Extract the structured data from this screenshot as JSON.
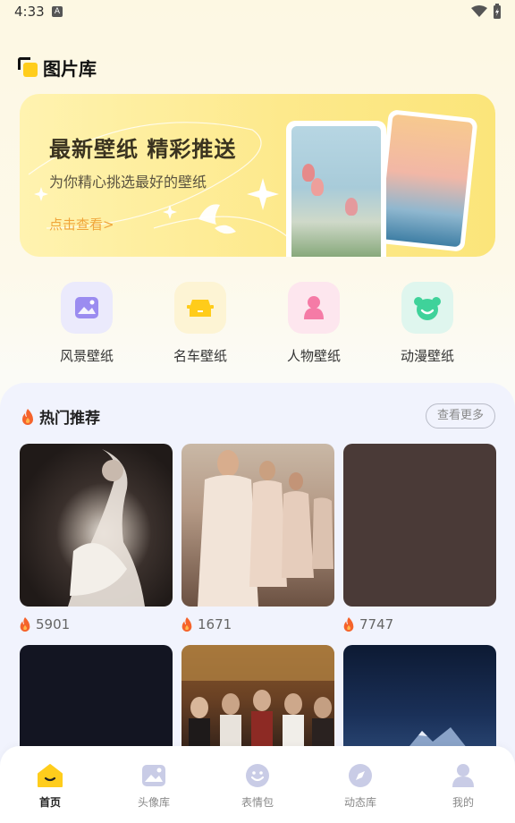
{
  "status": {
    "time": "4:33",
    "indicator": "A"
  },
  "page": {
    "title": "图片库"
  },
  "banner": {
    "title": "最新壁纸 精彩推送",
    "subtitle": "为你精心挑选最好的壁纸",
    "cta": "点击查看>"
  },
  "categories": [
    {
      "label": "风景壁纸",
      "icon": "landscape-icon",
      "bg": "#ebeafc",
      "color": "#9b8cf0"
    },
    {
      "label": "名车壁纸",
      "icon": "car-icon",
      "bg": "#fdf4d4",
      "color": "#ffcc1a"
    },
    {
      "label": "人物壁纸",
      "icon": "person-icon",
      "bg": "#fde6ee",
      "color": "#f57ba6"
    },
    {
      "label": "动漫壁纸",
      "icon": "bear-icon",
      "bg": "#dff6ee",
      "color": "#3fd29a"
    }
  ],
  "hot": {
    "title": "热门推荐",
    "more": "查看更多",
    "items": [
      {
        "likes": "5901"
      },
      {
        "likes": "1671"
      },
      {
        "likes": "7747"
      },
      {
        "likes": ""
      },
      {
        "likes": ""
      },
      {
        "likes": ""
      }
    ]
  },
  "nav": [
    {
      "label": "首页",
      "icon": "home-icon",
      "active": true
    },
    {
      "label": "头像库",
      "icon": "image-icon",
      "active": false
    },
    {
      "label": "表情包",
      "icon": "smiley-icon",
      "active": false
    },
    {
      "label": "动态库",
      "icon": "compass-icon",
      "active": false
    },
    {
      "label": "我的",
      "icon": "profile-icon",
      "active": false
    }
  ],
  "colors": {
    "accent": "#ffcd1c",
    "hot_bg": "#f1f3fd",
    "fire": "#f5632b"
  }
}
